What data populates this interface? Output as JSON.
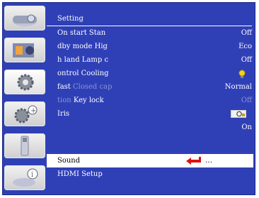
{
  "menu": {
    "title": "Setting",
    "rows": [
      {
        "label": "On start  Stan",
        "value": "Off"
      },
      {
        "label": "dby mode  Hig",
        "value": "Eco"
      },
      {
        "label": "h land  Lamp c",
        "value": "Off"
      },
      {
        "label": "ontrol  Cooling",
        "value": ""
      },
      {
        "label": "fast",
        "label_muted": "Closed cap",
        "value": "Normal"
      },
      {
        "label_muted": "tion",
        "label": "Key lock",
        "value": "Off"
      },
      {
        "label": "Iris",
        "value": ""
      },
      {
        "label": "",
        "value": "On"
      }
    ],
    "selected_row": {
      "label": "Sound",
      "value": "…"
    },
    "last_row": {
      "label": "HDMI Setup"
    }
  },
  "sidebar": {
    "items": [
      {
        "icon": "projector-icon"
      },
      {
        "icon": "image-adjust-icon"
      },
      {
        "icon": "setting-gears-icon",
        "active": true
      },
      {
        "icon": "expand-gears-icon"
      },
      {
        "icon": "usb-memory-icon"
      },
      {
        "icon": "info-icon"
      }
    ]
  },
  "colors": {
    "menu_bg": "#2f40b7",
    "selection_bg": "#ffffff",
    "arrow": "#dd1111",
    "muted_text": "#8a93d6"
  }
}
